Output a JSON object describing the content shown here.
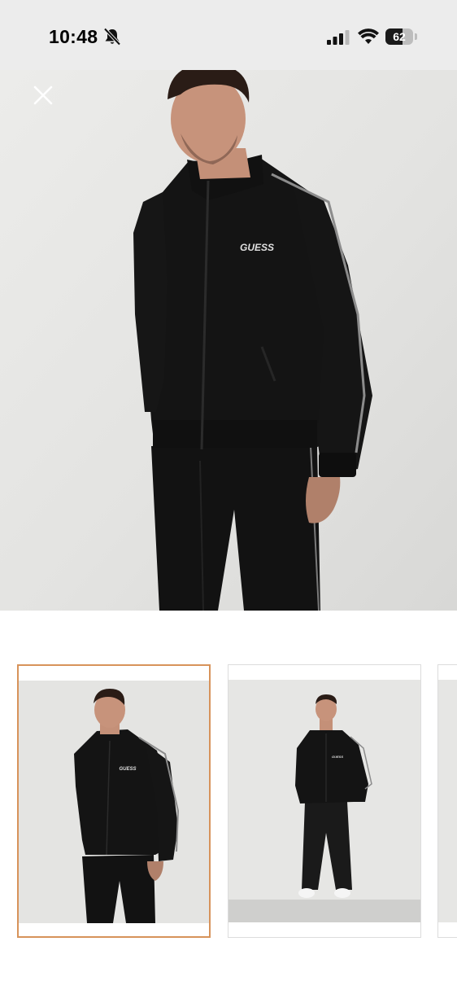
{
  "status_bar": {
    "time": "10:48",
    "battery_level": "62",
    "battery_fraction": 0.62,
    "icons": [
      "bell-slash-icon",
      "cellular-signal-icon",
      "wifi-icon",
      "battery-icon"
    ]
  },
  "header": {
    "close_icon": "close-icon"
  },
  "hero": {
    "brand_print": "GUESS"
  },
  "gallery": {
    "selected_index": 0,
    "thumbnails": [
      {
        "selected": true
      },
      {
        "selected": false
      },
      {
        "selected": false
      }
    ],
    "accent_color": "#d7935a"
  }
}
